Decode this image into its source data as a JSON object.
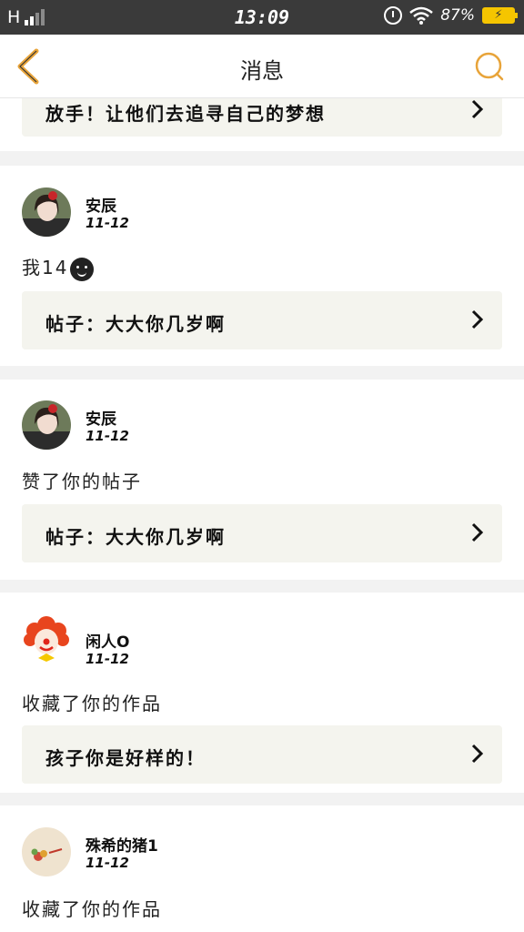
{
  "status_bar": {
    "network": "H",
    "time": "13:09",
    "battery_percent": "87%"
  },
  "nav": {
    "title": "消息",
    "accent_color": "#e8a43a"
  },
  "top_partial_post": {
    "text": "放手！让他们去追寻自己的梦想"
  },
  "messages": [
    {
      "user": "安辰",
      "date": "11-12",
      "content": "我14",
      "post": "帖子：大大你几岁啊"
    },
    {
      "user": "安辰",
      "date": "11-12",
      "content": "赞了你的帖子",
      "post": "帖子：大大你几岁啊"
    },
    {
      "user": "闲人O",
      "date": "11-12",
      "content": "收藏了你的作品",
      "post": "孩子你是好样的！"
    },
    {
      "user": "殊希的猪1",
      "date": "11-12",
      "content": "收藏了你的作品"
    }
  ]
}
